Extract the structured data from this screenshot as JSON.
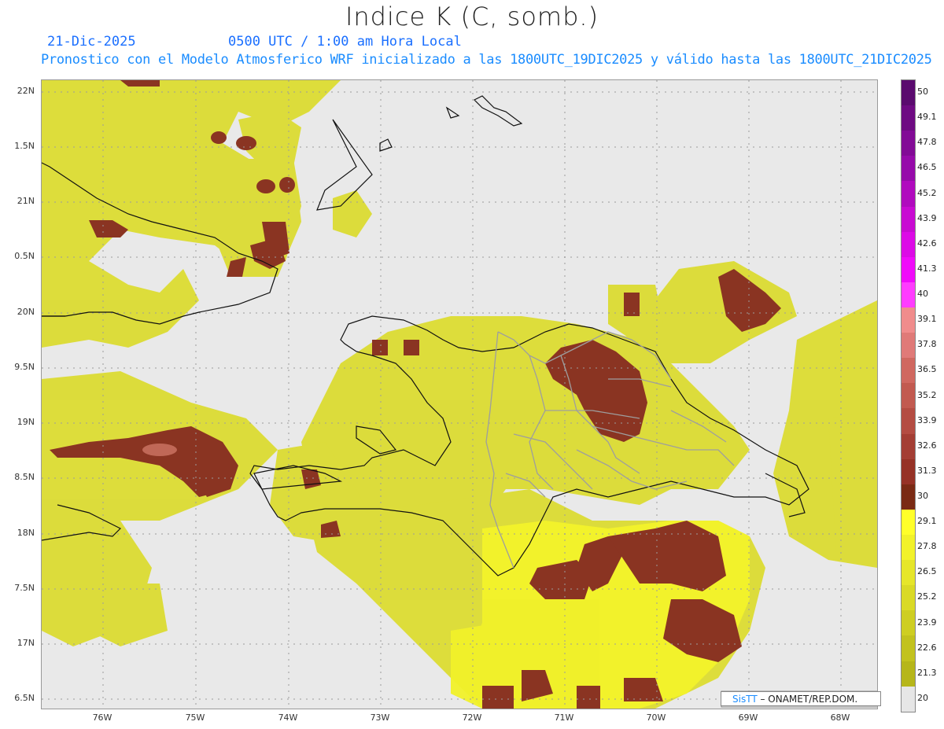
{
  "header": {
    "title": "Indice K (C, somb.)",
    "date": "21-Dic-2025",
    "time": "0500 UTC / 1:00 am Hora Local",
    "subtitle": "Pronostico con el Modelo Atmosferico WRF inicializado a las 1800UTC_19DIC2025 y válido hasta las  1800UTC_21DIC2025"
  },
  "axes": {
    "lat_labels": [
      "22N",
      "1.5N",
      "21N",
      "0.5N",
      "20N",
      "9.5N",
      "19N",
      "8.5N",
      "18N",
      "7.5N",
      "17N",
      "6.5N"
    ],
    "lon_labels": [
      "76W",
      "75W",
      "74W",
      "73W",
      "72W",
      "71W",
      "70W",
      "69W",
      "68W"
    ]
  },
  "colorbar": {
    "labels": [
      "50",
      "49.1",
      "47.8",
      "46.5",
      "45.2",
      "43.9",
      "42.6",
      "41.3",
      "40",
      "39.1",
      "37.8",
      "36.5",
      "35.2",
      "33.9",
      "32.6",
      "31.3",
      "30",
      "29.1",
      "27.8",
      "26.5",
      "25.2",
      "23.9",
      "22.6",
      "21.3",
      "20"
    ],
    "colors": [
      "#5a0a6e",
      "#6e0a82",
      "#820a96",
      "#960aaa",
      "#b00abe",
      "#c80ad2",
      "#dc0ae6",
      "#f00afa",
      "#ff3cff",
      "#f08c8c",
      "#e07a78",
      "#d06860",
      "#c25a50",
      "#b44c42",
      "#a43e34",
      "#963226",
      "#7a2a14",
      "#ffff2a",
      "#f2f22a",
      "#e6e62a",
      "#dada26",
      "#cece22",
      "#c2c21e",
      "#b6b61a",
      "#e6e6e6"
    ]
  },
  "credit": {
    "sis": "SisTT",
    "org": "– ONAMET/REP.DOM."
  }
}
